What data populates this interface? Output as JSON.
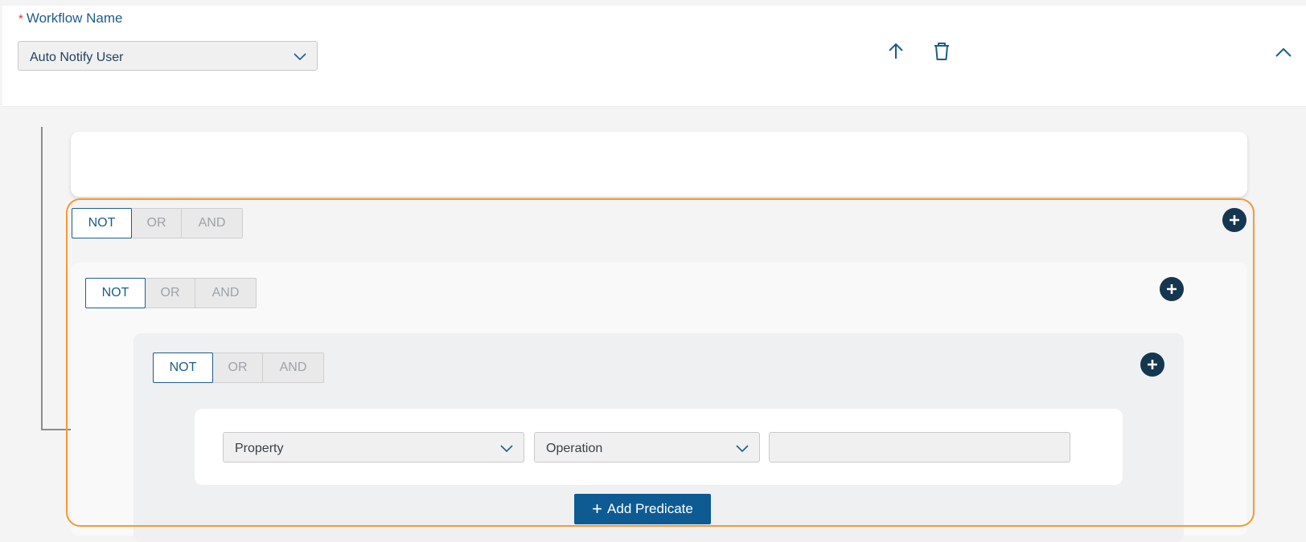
{
  "header": {
    "required_marker": "*",
    "workflow_label": "Workflow Name",
    "workflow_value": "Auto Notify User"
  },
  "groups": [
    {
      "operators": [
        "NOT",
        "OR",
        "AND"
      ],
      "selected": "NOT"
    },
    {
      "operators": [
        "NOT",
        "OR",
        "AND"
      ],
      "selected": "NOT"
    },
    {
      "operators": [
        "NOT",
        "OR",
        "AND"
      ],
      "selected": "NOT"
    }
  ],
  "predicate": {
    "property_placeholder": "Property",
    "operation_placeholder": "Operation",
    "value": ""
  },
  "add_predicate": {
    "plus": "+",
    "label": "Add Predicate"
  },
  "colors": {
    "accent": "#1b5e8a",
    "primary_button": "#0e5b93",
    "plus_circle": "#15364f",
    "highlight_frame": "#f39a32",
    "required": "#e0352b"
  },
  "icons": [
    "chevron-down-icon",
    "arrow-up-icon",
    "trash-icon",
    "chevron-up-icon",
    "plus-circle-icon"
  ]
}
